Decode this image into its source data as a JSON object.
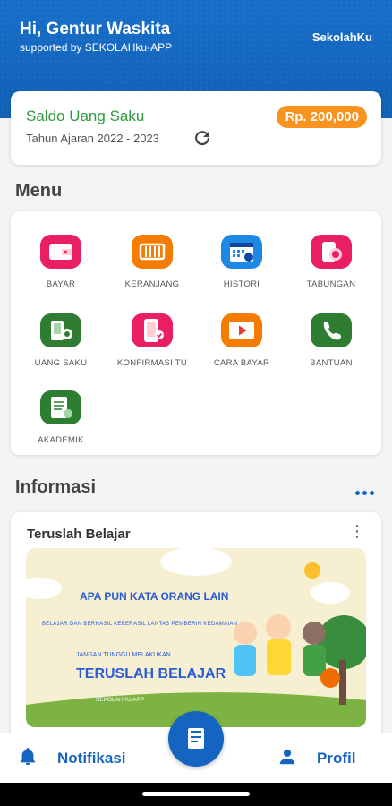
{
  "header": {
    "greeting": "Hi, Gentur Waskita",
    "supported": "supported by SEKOLAHku-APP",
    "brand": "SekolahKu"
  },
  "saldo": {
    "title": "Saldo Uang Saku",
    "year": "Tahun Ajaran 2022 - 2023",
    "amount": "Rp. 200,000"
  },
  "menu": {
    "title": "Menu",
    "items": [
      {
        "label": "BAYAR",
        "icon": "wallet-icon",
        "color": "#e91e63"
      },
      {
        "label": "KERANJANG",
        "icon": "cart-icon",
        "color": "#f57c00"
      },
      {
        "label": "HISTORI",
        "icon": "calendar-history-icon",
        "color": "#1e88e5"
      },
      {
        "label": "TABUNGAN",
        "icon": "savings-icon",
        "color": "#e91e63"
      },
      {
        "label": "UANG SAKU",
        "icon": "pocket-money-icon",
        "color": "#2e7d32"
      },
      {
        "label": "KONFIRMASI TU",
        "icon": "phone-confirm-icon",
        "color": "#e91e63"
      },
      {
        "label": "CARA BAYAR",
        "icon": "video-play-icon",
        "color": "#f57c00"
      },
      {
        "label": "BANTUAN",
        "icon": "phone-support-icon",
        "color": "#2e7d32"
      },
      {
        "label": "AKADEMIK",
        "icon": "academic-document-icon",
        "color": "#2e7d32"
      }
    ]
  },
  "informasi": {
    "title": "Informasi",
    "card_title": "Teruslah Belajar",
    "banner": {
      "line1": "APA PUN KATA ORANG LAIN",
      "line2": "BELAJAR DAN BERHASIL KEBERASIL LANTAS PEMBERIN KEDAMAIAN",
      "line3": "JANGAN TUNGGU MELAKUKAN",
      "line4": "TERUSLAH BELAJAR",
      "line5": "SEKOLAHKU APP"
    }
  },
  "bottom_nav": {
    "notifikasi": "Notifikasi",
    "profil": "Profil"
  }
}
